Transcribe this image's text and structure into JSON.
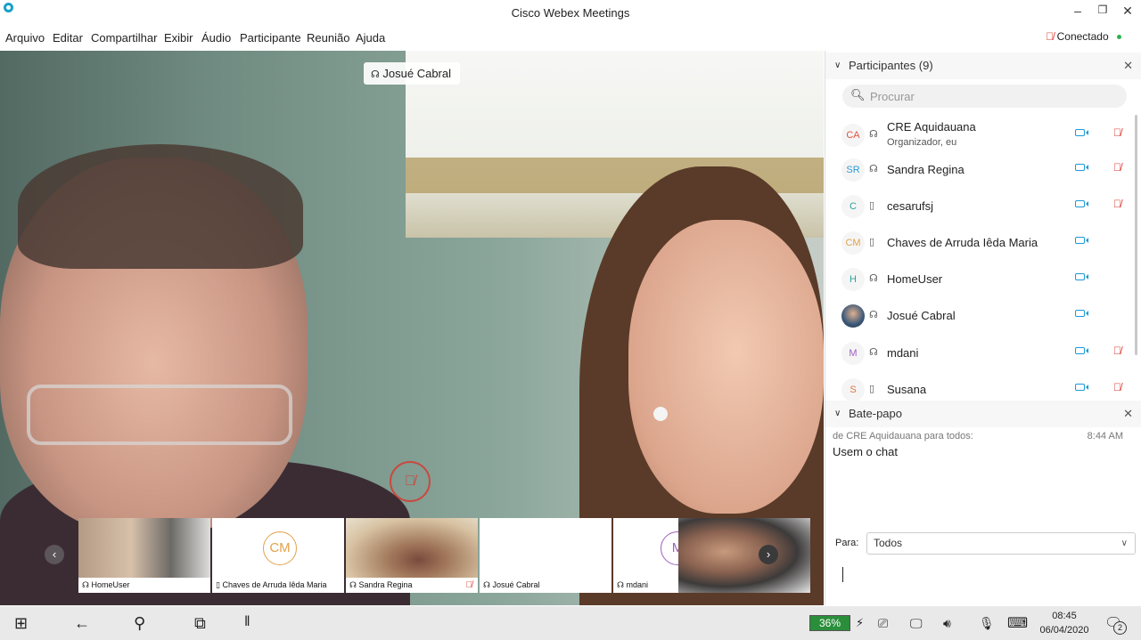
{
  "window": {
    "title": "Cisco Webex Meetings"
  },
  "menu": [
    "Arquivo",
    "Editar",
    "Compartilhar",
    "Exibir",
    "Áudio",
    "Participante",
    "Reunião",
    "Ajuda"
  ],
  "status": {
    "connection": "Conectado"
  },
  "video": {
    "active_speaker": "Josué  Cabral"
  },
  "filmstrip": [
    {
      "name": "HomeUser",
      "avatar": ""
    },
    {
      "name": "Chaves de Arruda Iêda Maria",
      "avatar": "CM"
    },
    {
      "name": "Sandra Regina",
      "avatar": ""
    },
    {
      "name": "Josué  Cabral",
      "avatar": ""
    },
    {
      "name": "mdani",
      "avatar": "M"
    }
  ],
  "participants": {
    "title": "Participantes (9)",
    "search_placeholder": "Procurar",
    "items": [
      {
        "initials": "CA",
        "name": "CRE Aquidauana",
        "role": "Organizador, eu",
        "muted": true,
        "color": "#e0533f"
      },
      {
        "initials": "SR",
        "name": "Sandra Regina",
        "role": "",
        "muted": true,
        "color": "#2e9bd6"
      },
      {
        "initials": "C",
        "name": "cesarufsj",
        "role": "",
        "muted": true,
        "color": "#2aa3a0"
      },
      {
        "initials": "CM",
        "name": "Chaves de Arruda Iêda Maria",
        "role": "",
        "muted": false,
        "color": "#e1a24b"
      },
      {
        "initials": "H",
        "name": "HomeUser",
        "role": "",
        "muted": false,
        "color": "#2aa3a0"
      },
      {
        "initials": "",
        "name": "Josué  Cabral",
        "role": "",
        "muted": false,
        "color": "#3b5878"
      },
      {
        "initials": "M",
        "name": "mdani",
        "role": "",
        "muted": true,
        "color": "#a05fbf"
      },
      {
        "initials": "S",
        "name": "Susana",
        "role": "",
        "muted": true,
        "color": "#e0733f"
      }
    ]
  },
  "chat": {
    "title": "Bate-papo",
    "messages": [
      {
        "meta": "de CRE Aquidauana para todos:",
        "time": "8:44 AM",
        "text": "Usem o chat"
      }
    ],
    "to_label": "Para:",
    "to_value": "Todos"
  },
  "taskbar": {
    "battery": "36%",
    "time": "08:45",
    "date": "06/04/2020",
    "notifications": "2"
  }
}
